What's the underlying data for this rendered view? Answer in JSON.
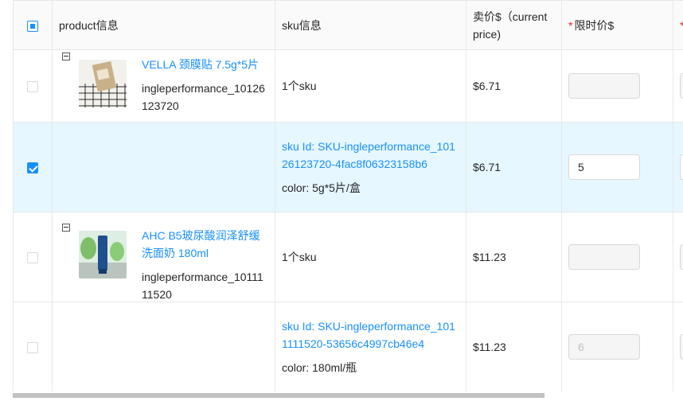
{
  "table": {
    "headers": {
      "product": "product信息",
      "sku": "sku信息",
      "price": "卖价$（current price)",
      "required_mark": "*",
      "limit_price": "限时价$",
      "next_required_mark": "*"
    },
    "rows": [
      {
        "type": "product",
        "title": "VELLA 颈膜贴 7.5g*5片",
        "code": "ingleperformance_10126123720",
        "sku_summary": "1个sku",
        "price": "$6.71",
        "limit_value": ""
      },
      {
        "type": "sku",
        "sku_id": "sku Id: SKU-ingleperformance_10126123720-4fac8f06323158b6",
        "color": "color: 5g*5片/盒",
        "price": "$6.71",
        "limit_value": "5"
      },
      {
        "type": "product",
        "title": "AHC B5玻尿酸润泽舒缓洗面奶 180ml",
        "code": "ingleperformance_1011111520",
        "sku_summary": "1个sku",
        "price": "$11.23",
        "limit_value": ""
      },
      {
        "type": "sku",
        "sku_id": "sku Id: SKU-ingleperformance_1011111520-53656c4997cb46e4",
        "color": "color: 180ml/瓶",
        "price": "$11.23",
        "limit_value": "6"
      }
    ]
  },
  "colors": {
    "accent": "#1890ff",
    "selected_row_bg": "#e6f7ff",
    "header_bg": "#fafafa",
    "required": "#f5222d"
  }
}
